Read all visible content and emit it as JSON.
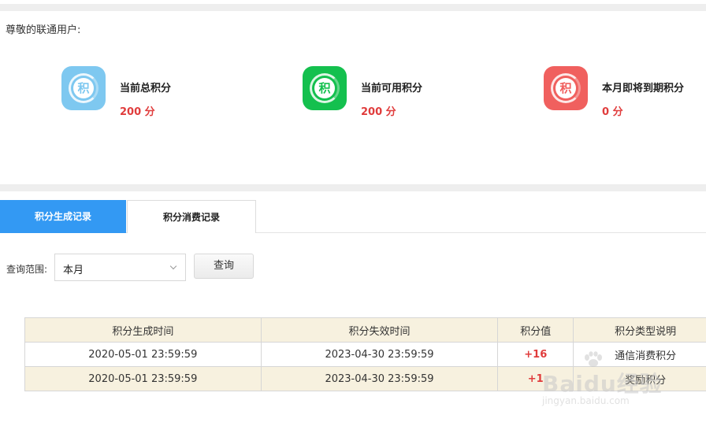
{
  "greeting": "尊敬的联通用户:",
  "stats": [
    {
      "label": "当前总积分",
      "value": "200 分",
      "icon_char": "积",
      "color": "#7ec8f0",
      "icon": "points-icon"
    },
    {
      "label": "当前可用积分",
      "value": "200 分",
      "icon_char": "积",
      "color": "#14c04e",
      "icon": "points-icon"
    },
    {
      "label": "本月即将到期积分",
      "value": "0 分",
      "icon_char": "积",
      "color": "#f0605e",
      "icon": "points-icon"
    }
  ],
  "tabs": [
    {
      "label": "积分生成记录",
      "active": true
    },
    {
      "label": "积分消费记录",
      "active": false
    }
  ],
  "filter": {
    "label": "查询范围:",
    "selected": "本月",
    "button": "查询"
  },
  "table": {
    "headers": [
      "积分生成时间",
      "积分失效时间",
      "积分值",
      "积分类型说明"
    ],
    "rows": [
      [
        "2020-05-01 23:59:59",
        "2023-04-30 23:59:59",
        "+16",
        "通信消费积分"
      ],
      [
        "2020-05-01 23:59:59",
        "2023-04-30 23:59:59",
        "+1",
        "奖励积分"
      ]
    ]
  },
  "watermark": {
    "logo": "Baidu经验",
    "url": "jingyan.baidu.com"
  },
  "colors": {
    "accent": "#3399f3",
    "points_red": "#e03c3c",
    "table_header_bg": "#f7f1df"
  }
}
